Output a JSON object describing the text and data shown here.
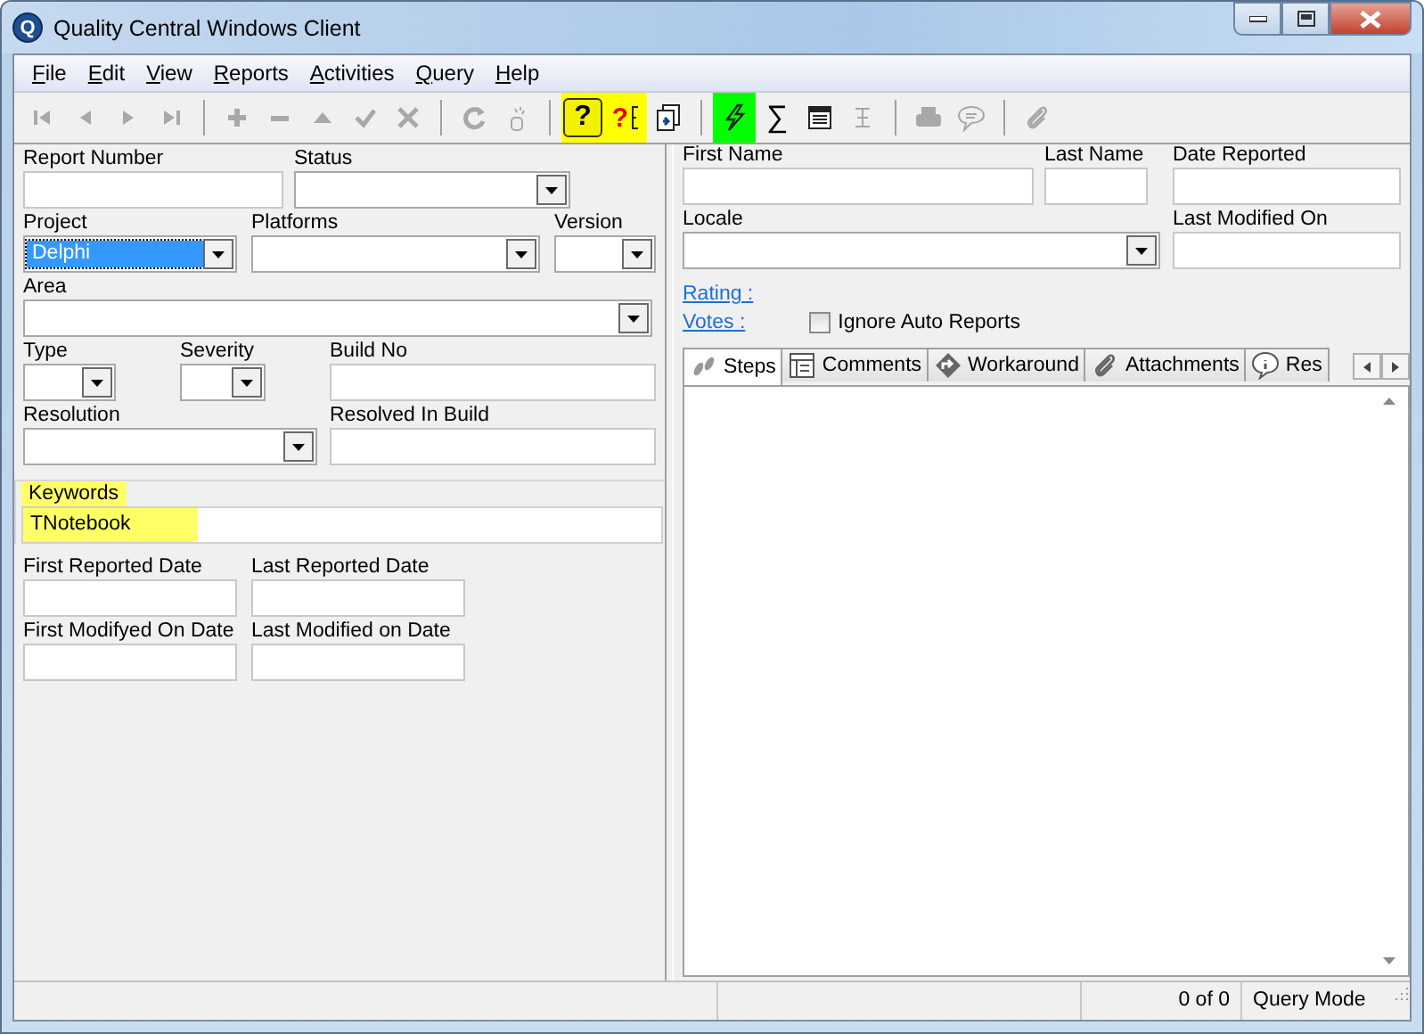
{
  "window": {
    "title": "Quality Central Windows Client",
    "icon_text": "Q"
  },
  "menu": [
    "File",
    "Edit",
    "View",
    "Reports",
    "Activities",
    "Query",
    "Help"
  ],
  "toolbar": [
    [
      {
        "kind": "first",
        "disabled": true,
        "pressed": false
      },
      {
        "kind": "prev",
        "disabled": true,
        "pressed": false
      },
      {
        "kind": "next",
        "disabled": true,
        "pressed": false
      },
      {
        "kind": "last",
        "disabled": true,
        "pressed": false
      }
    ],
    [
      {
        "kind": "add",
        "disabled": true,
        "pressed": false
      },
      {
        "kind": "remove",
        "disabled": true,
        "pressed": false
      },
      {
        "kind": "up",
        "disabled": true,
        "pressed": false
      },
      {
        "kind": "check",
        "disabled": true,
        "pressed": false
      },
      {
        "kind": "cancel",
        "disabled": true,
        "pressed": false
      }
    ],
    [
      {
        "kind": "refresh",
        "disabled": true,
        "pressed": false
      },
      {
        "kind": "clear",
        "disabled": true,
        "pressed": false
      }
    ],
    [
      {
        "kind": "help",
        "text": "?",
        "disabled": false,
        "pressed": true,
        "color": "#ffff00"
      },
      {
        "kind": "context-help",
        "text": "?",
        "disabled": false,
        "pressed": false,
        "color": "#ffff00"
      },
      {
        "kind": "copy",
        "disabled": false,
        "pressed": false
      }
    ],
    [
      {
        "kind": "lightning",
        "disabled": false,
        "pressed": false,
        "color": "#00ff00"
      },
      {
        "kind": "sigma",
        "text": "∑",
        "disabled": false,
        "pressed": false
      },
      {
        "kind": "form",
        "disabled": false,
        "pressed": false
      },
      {
        "kind": "ibeam",
        "disabled": true,
        "pressed": false
      }
    ],
    [
      {
        "kind": "print",
        "disabled": true,
        "pressed": false
      },
      {
        "kind": "speech",
        "disabled": true,
        "pressed": false
      }
    ],
    [
      {
        "kind": "clip",
        "disabled": true,
        "pressed": false
      }
    ]
  ],
  "left_rows": [
    [
      {
        "label": "Report Number",
        "kind": "text"
      },
      {
        "label": "Status",
        "kind": "select"
      }
    ],
    [
      {
        "label": "Project",
        "kind": "select",
        "value": "Delphi",
        "focused": true
      },
      {
        "label": "Platforms",
        "kind": "select",
        "focused": false
      },
      {
        "label": "Version",
        "kind": "select",
        "focused": false
      }
    ],
    [
      {
        "label": "Area",
        "kind": "select"
      }
    ],
    [
      {
        "label": "Type",
        "kind": "select"
      },
      {
        "label": "Severity",
        "kind": "select"
      },
      {
        "label": "Build No",
        "kind": "text"
      }
    ],
    [
      {
        "label": "Resolution",
        "kind": "select"
      },
      {
        "label": "Resolved In Build",
        "kind": "text"
      }
    ]
  ],
  "keywords": {
    "label": "Keywords",
    "value": "TNotebook",
    "highlighted": true
  },
  "date_rows": [
    [
      {
        "label": "First Reported Date",
        "kind": "text"
      },
      {
        "label": "Last Reported Date",
        "kind": "text"
      }
    ],
    [
      {
        "label": "First Modifyed On Date",
        "kind": "text"
      },
      {
        "label": "Last Modified on Date",
        "kind": "text"
      }
    ]
  ],
  "right_rows": [
    [
      {
        "label": "First Name",
        "kind": "text"
      },
      {
        "label": "Last Name",
        "kind": "text"
      },
      {
        "label": "Date Reported",
        "kind": "text"
      }
    ],
    [
      {
        "label": "Locale",
        "kind": "select"
      },
      {
        "label": "Last Modified On",
        "kind": "text"
      }
    ]
  ],
  "links": [
    "Rating :",
    "Votes :"
  ],
  "ignore_auto_reports": {
    "label": "Ignore Auto Reports",
    "checked": false
  },
  "tabs": [
    {
      "label": "Steps",
      "kind": "steps",
      "selected": true
    },
    {
      "label": "Comments",
      "kind": "comments",
      "selected": false
    },
    {
      "label": "Workaround",
      "kind": "workaround",
      "selected": false
    },
    {
      "label": "Attachments",
      "kind": "clip",
      "selected": false
    },
    {
      "label": "Res",
      "kind": "info",
      "selected": false
    }
  ],
  "status_bar": {
    "count": "0 of 0",
    "mode": "Query Mode"
  }
}
